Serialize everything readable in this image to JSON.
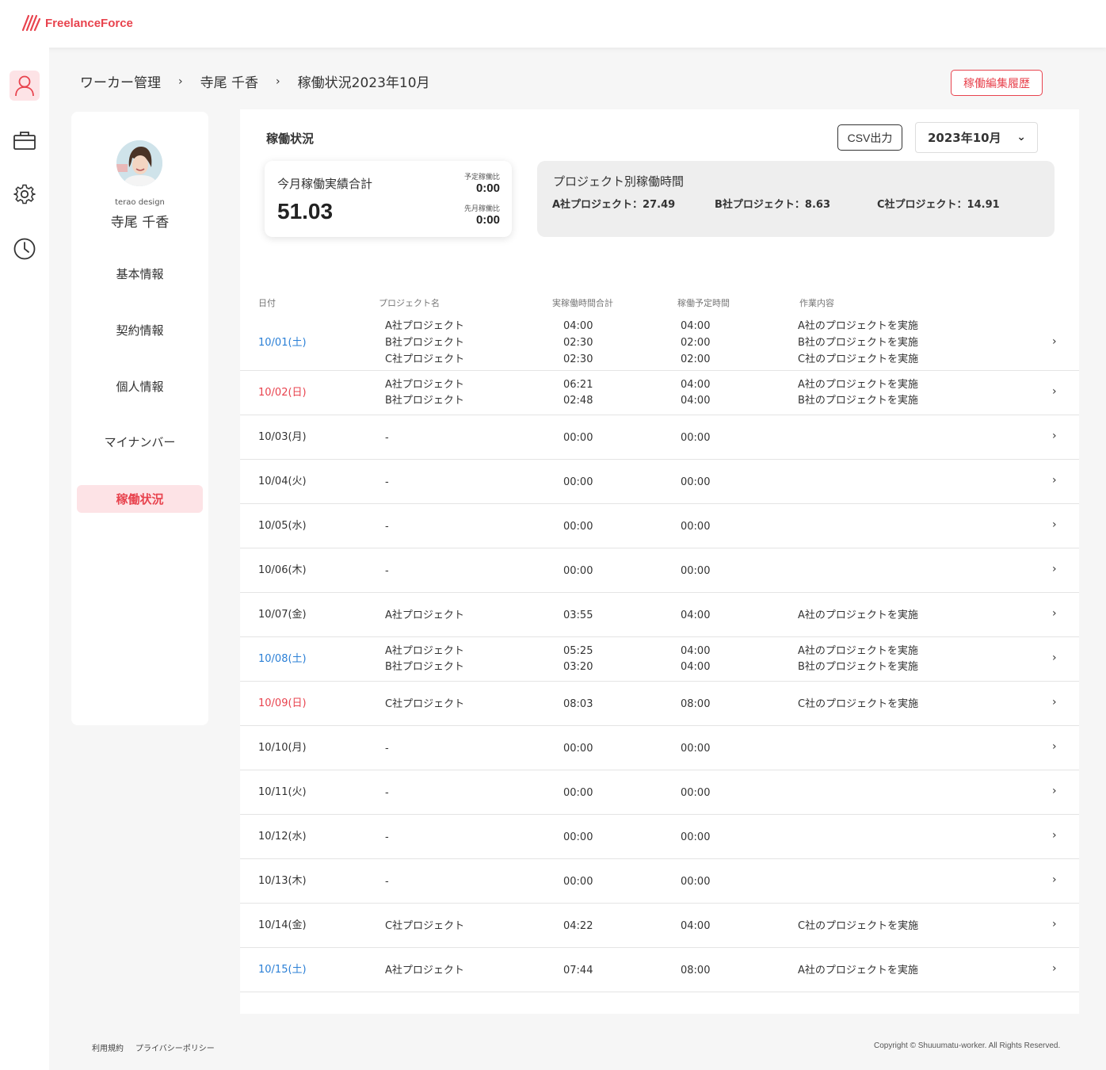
{
  "app": {
    "logo_text": "FreelanceForce",
    "accent": "#e8434e"
  },
  "rail": [
    "user-icon",
    "briefcase-icon",
    "gear-icon",
    "clock-icon"
  ],
  "breadcrumb": {
    "items": [
      "ワーカー管理",
      "寺尾 千香",
      "稼働状況2023年10月"
    ]
  },
  "header": {
    "history_button": "稼働編集履歴"
  },
  "profile": {
    "company": "terao design",
    "name": "寺尾 千香",
    "menu": [
      {
        "label": "基本情報",
        "active": false
      },
      {
        "label": "契約情報",
        "active": false
      },
      {
        "label": "個人情報",
        "active": false
      },
      {
        "label": "マイナンバー",
        "active": false
      },
      {
        "label": "稼働状況",
        "active": true
      }
    ]
  },
  "main": {
    "title": "稼働状況",
    "csv_button": "CSV出力",
    "month_select": "2023年10月",
    "total": {
      "label": "今月稼働実績合計",
      "value": "51.03",
      "plan_ratio_label": "予定稼働比",
      "plan_ratio_value": "0:00",
      "prev_ratio_label": "先月稼働比",
      "prev_ratio_value": "0:00"
    },
    "projects": {
      "title": "プロジェクト別稼働時間",
      "items": [
        "A社プロジェクト：27.49",
        "B社プロジェクト：8.63",
        "C社プロジェクト：14.91"
      ]
    },
    "columns": [
      "日付",
      "プロジェクト名",
      "実稼働時間合計",
      "稼働予定時間",
      "作業内容"
    ],
    "rows": [
      {
        "date": "10/01(土)",
        "day": "sat",
        "entries": [
          {
            "project": "A社プロジェクト",
            "actual": "04:00",
            "plan": "04:00",
            "task": "A社のプロジェクトを実施"
          },
          {
            "project": "B社プロジェクト",
            "actual": "02:30",
            "plan": "02:00",
            "task": "B社のプロジェクトを実施"
          },
          {
            "project": "C社プロジェクト",
            "actual": "02:30",
            "plan": "02:00",
            "task": "C社のプロジェクトを実施"
          }
        ]
      },
      {
        "date": "10/02(日)",
        "day": "sun",
        "entries": [
          {
            "project": "A社プロジェクト",
            "actual": "06:21",
            "plan": "04:00",
            "task": "A社のプロジェクトを実施"
          },
          {
            "project": "B社プロジェクト",
            "actual": "02:48",
            "plan": "04:00",
            "task": "B社のプロジェクトを実施"
          }
        ]
      },
      {
        "date": "10/03(月)",
        "day": "weekday",
        "entries": [
          {
            "project": "-",
            "actual": "00:00",
            "plan": "00:00",
            "task": ""
          }
        ]
      },
      {
        "date": "10/04(火)",
        "day": "weekday",
        "entries": [
          {
            "project": "-",
            "actual": "00:00",
            "plan": "00:00",
            "task": ""
          }
        ]
      },
      {
        "date": "10/05(水)",
        "day": "weekday",
        "entries": [
          {
            "project": "-",
            "actual": "00:00",
            "plan": "00:00",
            "task": ""
          }
        ]
      },
      {
        "date": "10/06(木)",
        "day": "weekday",
        "entries": [
          {
            "project": "-",
            "actual": "00:00",
            "plan": "00:00",
            "task": ""
          }
        ]
      },
      {
        "date": "10/07(金)",
        "day": "weekday",
        "entries": [
          {
            "project": "A社プロジェクト",
            "actual": "03:55",
            "plan": "04:00",
            "task": "A社のプロジェクトを実施"
          }
        ]
      },
      {
        "date": "10/08(土)",
        "day": "sat",
        "entries": [
          {
            "project": "A社プロジェクト",
            "actual": "05:25",
            "plan": "04:00",
            "task": "A社のプロジェクトを実施"
          },
          {
            "project": "B社プロジェクト",
            "actual": "03:20",
            "plan": "04:00",
            "task": "B社のプロジェクトを実施"
          }
        ]
      },
      {
        "date": "10/09(日)",
        "day": "sun",
        "entries": [
          {
            "project": "C社プロジェクト",
            "actual": "08:03",
            "plan": "08:00",
            "task": "C社のプロジェクトを実施"
          }
        ]
      },
      {
        "date": "10/10(月)",
        "day": "weekday",
        "entries": [
          {
            "project": "-",
            "actual": "00:00",
            "plan": "00:00",
            "task": ""
          }
        ]
      },
      {
        "date": "10/11(火)",
        "day": "weekday",
        "entries": [
          {
            "project": "-",
            "actual": "00:00",
            "plan": "00:00",
            "task": ""
          }
        ]
      },
      {
        "date": "10/12(水)",
        "day": "weekday",
        "entries": [
          {
            "project": "-",
            "actual": "00:00",
            "plan": "00:00",
            "task": ""
          }
        ]
      },
      {
        "date": "10/13(木)",
        "day": "weekday",
        "entries": [
          {
            "project": "-",
            "actual": "00:00",
            "plan": "00:00",
            "task": ""
          }
        ]
      },
      {
        "date": "10/14(金)",
        "day": "weekday",
        "entries": [
          {
            "project": "C社プロジェクト",
            "actual": "04:22",
            "plan": "04:00",
            "task": "C社のプロジェクトを実施"
          }
        ]
      },
      {
        "date": "10/15(土)",
        "day": "sat",
        "entries": [
          {
            "project": "A社プロジェクト",
            "actual": "07:44",
            "plan": "08:00",
            "task": "A社のプロジェクトを実施"
          }
        ]
      }
    ]
  },
  "footer": {
    "terms": "利用規約",
    "privacy": "プライバシーポリシー",
    "copyright": "Copyright © Shuuumatu-worker. All Rights Reserved."
  }
}
